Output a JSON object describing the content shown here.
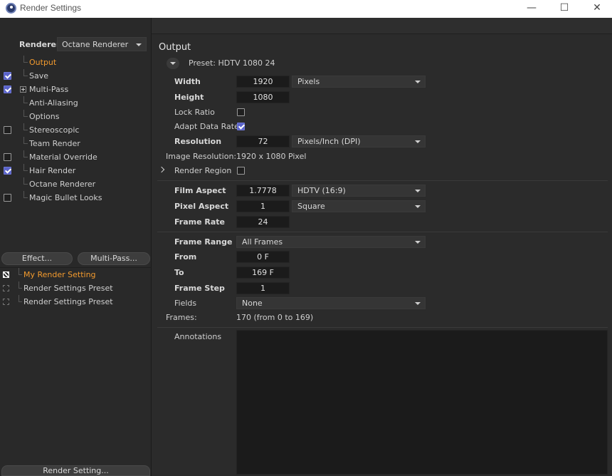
{
  "window": {
    "title": "Render Settings",
    "minimize_glyph": "—",
    "maximize_glyph": "☐",
    "close_glyph": "✕"
  },
  "left": {
    "renderer_label": "Renderer",
    "renderer_value": "Octane Renderer",
    "tree": [
      {
        "label": "Output",
        "checkbox": null,
        "active": true
      },
      {
        "label": "Save",
        "checkbox": true
      },
      {
        "label": "Multi-Pass",
        "checkbox": true,
        "expandable": true
      },
      {
        "label": "Anti-Aliasing",
        "checkbox": null
      },
      {
        "label": "Options",
        "checkbox": null
      },
      {
        "label": "Stereoscopic",
        "checkbox": false
      },
      {
        "label": "Team Render",
        "checkbox": null
      },
      {
        "label": "Material Override",
        "checkbox": false
      },
      {
        "label": "Hair Render",
        "checkbox": true
      },
      {
        "label": "Octane Renderer",
        "checkbox": null
      },
      {
        "label": "Magic Bullet Looks",
        "checkbox": false
      }
    ],
    "effect_button": "Effect...",
    "multipass_button": "Multi-Pass...",
    "settings": [
      {
        "label": "My Render Setting",
        "active": true
      },
      {
        "label": "Render Settings Preset",
        "active": false
      },
      {
        "label": "Render Settings Preset",
        "active": false
      }
    ],
    "render_setting_button": "Render Setting..."
  },
  "output": {
    "title": "Output",
    "preset": "Preset: HDTV 1080 24",
    "width_label": "Width",
    "width_value": "1920",
    "width_unit": "Pixels",
    "height_label": "Height",
    "height_value": "1080",
    "lock_ratio_label": "Lock Ratio",
    "lock_ratio": false,
    "adapt_label": "Adapt Data Rate",
    "adapt_data_rate": true,
    "resolution_label": "Resolution",
    "resolution_value": "72",
    "resolution_unit": "Pixels/Inch (DPI)",
    "image_res_label": "Image Resolution:",
    "image_res_value": "1920 x 1080 Pixel",
    "render_region_label": "Render Region",
    "render_region": false,
    "film_aspect_label": "Film Aspect",
    "film_aspect_value": "1.7778",
    "film_aspect_preset": "HDTV (16:9)",
    "pixel_aspect_label": "Pixel Aspect",
    "pixel_aspect_value": "1",
    "pixel_aspect_preset": "Square",
    "frame_rate_label": "Frame Rate",
    "frame_rate_value": "24",
    "frame_range_label": "Frame Range",
    "frame_range_value": "All Frames",
    "from_label": "From",
    "from_value": "0 F",
    "to_label": "To",
    "to_value": "169 F",
    "frame_step_label": "Frame Step",
    "frame_step_value": "1",
    "fields_label": "Fields",
    "fields_value": "None",
    "frames_label": "Frames:",
    "frames_value": "170 (from 0 to 169)",
    "annotations_label": "Annotations"
  }
}
